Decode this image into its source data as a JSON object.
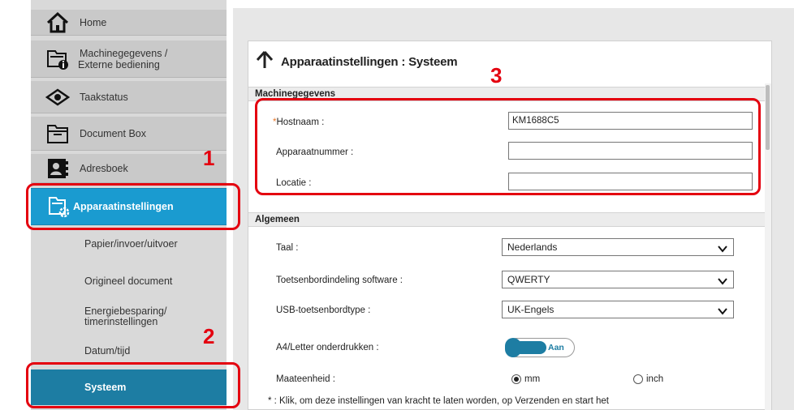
{
  "sidebar": {
    "home": "Home",
    "machine_info": [
      "Machinegegevens /",
      "Externe bediening"
    ],
    "job_status": "Taakstatus",
    "document_box": "Document Box",
    "address_book": "Adresboek",
    "device_settings": "Apparaatinstellingen",
    "sub": {
      "paper": "Papier/invoer/uitvoer",
      "original": "Origineel document",
      "energy": [
        "Energiebesparing/",
        "timerinstellingen"
      ],
      "datetime": "Datum/tijd",
      "system": "Systeem"
    }
  },
  "page": {
    "title": "Apparaatinstellingen : Systeem"
  },
  "machine_section": {
    "header": "Machinegegevens",
    "required_mark": "*",
    "hostname_label": "Hostnaam :",
    "hostname_value": "KM1688C5",
    "asset_label": "Apparaatnummer :",
    "asset_value": "",
    "location_label": "Locatie :",
    "location_value": ""
  },
  "general_section": {
    "header": "Algemeen",
    "language_label": "Taal :",
    "language_value": "Nederlands",
    "keyboard_sw_label": "Toetsenbordindeling software :",
    "keyboard_sw_value": "QWERTY",
    "usb_kb_label": "USB-toetsenbordtype :",
    "usb_kb_value": "UK-Engels",
    "a4_letter_label": "A4/Letter onderdrukken :",
    "a4_letter_value": "Aan",
    "unit_label": "Maateenheid :",
    "unit_mm": "mm",
    "unit_inch": "inch",
    "unit_selected": "mm"
  },
  "footer": {
    "note": "* :  Klik, om deze instellingen van kracht te laten worden, op Verzenden en start het"
  },
  "callouts": {
    "one": "1",
    "two": "2",
    "three": "3"
  },
  "colors": {
    "accent": "#1a9bd0",
    "selected": "#1d7da3",
    "callout": "#e4000f",
    "required": "#e8782b"
  }
}
